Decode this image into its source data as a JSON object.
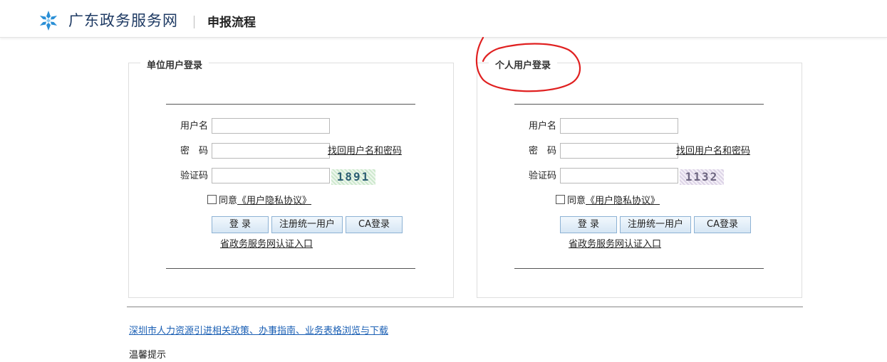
{
  "header": {
    "site_name": "广东政务服务网",
    "page_title": "申报流程",
    "logo_icon": "snowflake-logo-icon",
    "brand_color": "#2a8fd6"
  },
  "unit_login": {
    "legend": "单位用户登录",
    "username_label": "用户名",
    "password_label": "密　码",
    "captcha_label": "验证码",
    "username_value": "",
    "password_value": "",
    "captcha_value": "",
    "find_link": "找回用户名和密码",
    "captcha_code": "1891",
    "agree_prefix": "同意",
    "agree_link": "《用户隐私协议》",
    "login_button": "登 录",
    "register_button": "注册统一用户",
    "ca_button": "CA登录",
    "portal_link": "省政务服务网认证入口"
  },
  "personal_login": {
    "legend": "个人用户登录",
    "username_label": "用户名",
    "password_label": "密　码",
    "captcha_label": "验证码",
    "username_value": "",
    "password_value": "",
    "captcha_value": "",
    "find_link": "找回用户名和密码",
    "captcha_code": "1132",
    "agree_prefix": "同意",
    "agree_link": "《用户隐私协议》",
    "login_button": "登 录",
    "register_button": "注册统一用户",
    "ca_button": "CA登录",
    "portal_link": "省政务服务网认证入口"
  },
  "footer": {
    "policy_link": "深圳市人力资源引进相关政策、办事指南、业务表格浏览与下载",
    "partial_text": "温馨提示"
  },
  "annotation": {
    "color": "#e02020"
  }
}
